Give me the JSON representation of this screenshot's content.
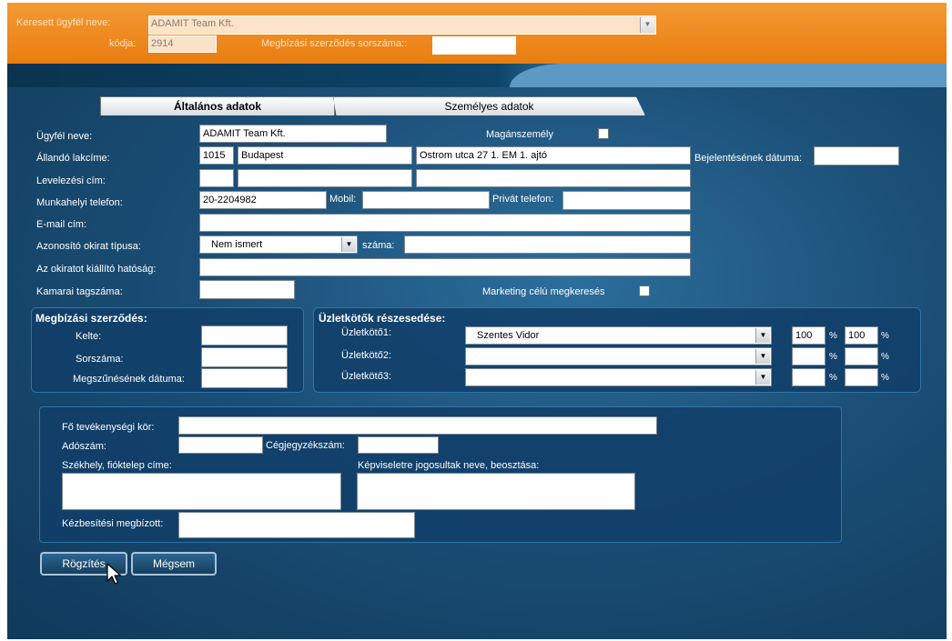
{
  "header": {
    "searched_client_label": "Keresett ügyfél neve:",
    "searched_client_value": "ADAMIT Team Kft.",
    "code_label": "kódja:",
    "code_value": "2914",
    "contract_number_label": "Megbízási szerződés sorszáma::",
    "contract_number_value": ""
  },
  "tabs": [
    {
      "label": "Általános adatok",
      "active": true
    },
    {
      "label": "Személyes adatok",
      "active": false
    }
  ],
  "form": {
    "client_name_label": "Ügyfél neve:",
    "client_name_value": "ADAMIT Team Kft.",
    "private_person_label": "Magánszemély",
    "private_person_checked": false,
    "permanent_address_label": "Állandó lakcíme:",
    "zip_value": "1015",
    "city_value": "Budapest",
    "street_value": "Ostrom utca 27 1. EM 1. ajtó",
    "registration_date_label": "Bejelentésének dátuma:",
    "registration_date_value": "",
    "mailing_address_label": "Levelezési cím:",
    "work_phone_label": "Munkahelyi telefon:",
    "work_phone_value": "20-2204982",
    "mobile_label": "Mobil:",
    "mobile_value": "",
    "private_phone_label": "Privát telefon:",
    "private_phone_value": "",
    "email_label": "E-mail cím:",
    "email_value": "",
    "id_type_label": "Azonosító okirat típusa:",
    "id_type_value": "Nem ismert",
    "id_number_label": "száma:",
    "id_number_value": "",
    "issuing_authority_label": "Az okiratot kiállító hatóság:",
    "issuing_authority_value": "",
    "chamber_label": "Kamarai tagszáma:",
    "chamber_value": "",
    "marketing_label": "Marketing célú megkeresés",
    "marketing_checked": false
  },
  "contract": {
    "title": "Megbízási szerződés:",
    "date_label": "Kelte:",
    "date_value": "",
    "number_label": "Sorszáma:",
    "number_value": "",
    "end_date_label": "Megszűnésének dátuma:",
    "end_date_value": ""
  },
  "brokers": {
    "title": "Üzletkötők részesedése:",
    "rows": [
      {
        "label": "Üzletkötő1:",
        "value": "Szentes Vidor",
        "pct1": "100",
        "pct2": "100"
      },
      {
        "label": "Üzletkötő2:",
        "value": "",
        "pct1": "",
        "pct2": ""
      },
      {
        "label": "Üzletkötő3:",
        "value": "",
        "pct1": "",
        "pct2": ""
      }
    ],
    "pct_symbol": "%"
  },
  "company": {
    "activity_label": "Fő tevékenységi kör:",
    "activity_value": "",
    "tax_label": "Adószám:",
    "tax_value": "",
    "reg_label": "Cégjegyzékszám:",
    "reg_value": "",
    "seat_label": "Székhely, fióktelep címe:",
    "seat_value": "",
    "reps_label": "Képviseletre jogosultak neve, beosztása:",
    "reps_value": "",
    "delivery_label": "Kézbesítési megbízott:",
    "delivery_value": ""
  },
  "buttons": {
    "save_label": "Rögzítés",
    "cancel_label": "Mégsem"
  },
  "colors": {
    "header_orange": "#e97d10",
    "background_blue": "#10395a",
    "panel_border": "#2f74a8"
  }
}
